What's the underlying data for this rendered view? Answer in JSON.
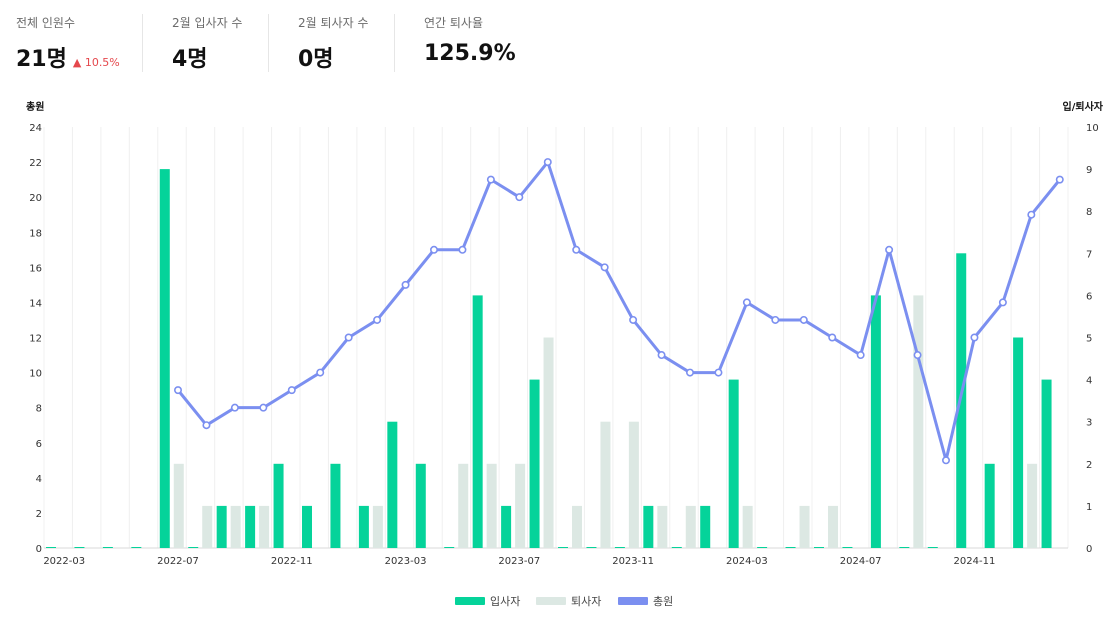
{
  "kpis": [
    {
      "label": "전체 인원수",
      "value": "21명",
      "delta": "▲ 10.5%"
    },
    {
      "label": "2월 입사자 수",
      "value": "4명"
    },
    {
      "label": "2월 퇴사자 수",
      "value": "0명"
    },
    {
      "label": "연간 퇴사율",
      "value": "125.9%"
    }
  ],
  "colors": {
    "hires": "#05d39a",
    "exits": "#dce8e3",
    "total": "#7b8ff0"
  },
  "chart_data": {
    "type": "bar",
    "x_tick_labels": [
      "2022-03",
      "2022-07",
      "2022-11",
      "2023-03",
      "2023-07",
      "2023-11",
      "2024-03",
      "2024-07",
      "2024-11"
    ],
    "y_left_label": "총원",
    "y_right_label": "입/퇴사자",
    "y_left_ticks": [
      "0",
      "2",
      "4",
      "6",
      "8",
      "10",
      "12",
      "14",
      "16",
      "18",
      "20",
      "22",
      "24"
    ],
    "y_right_ticks": [
      "0",
      "1",
      "2",
      "3",
      "4",
      "5",
      "6",
      "7",
      "8",
      "9",
      "10"
    ],
    "ylim_left": [
      0,
      24
    ],
    "ylim_right": [
      0,
      10
    ],
    "categories": [
      "2022-03",
      "2022-04",
      "2022-05",
      "2022-06",
      "2022-07",
      "2022-08",
      "2022-09",
      "2022-10",
      "2022-11",
      "2022-12",
      "2023-01",
      "2023-02",
      "2023-03",
      "2023-04",
      "2023-05",
      "2023-06",
      "2023-07",
      "2023-08",
      "2023-09",
      "2023-10",
      "2023-11",
      "2023-12",
      "2024-01",
      "2024-02",
      "2024-03",
      "2024-04",
      "2024-05",
      "2024-06",
      "2024-07",
      "2024-08",
      "2024-09",
      "2024-10",
      "2024-11",
      "2024-12",
      "2025-01",
      "2025-02"
    ],
    "series": [
      {
        "name": "입사자",
        "kind": "bar",
        "axis": "right",
        "values": [
          0,
          0,
          0,
          0,
          9,
          0,
          1,
          1,
          2,
          1,
          2,
          1,
          3,
          2,
          0,
          6,
          1,
          4,
          0,
          0,
          0,
          1,
          0,
          1,
          4,
          0,
          0,
          0,
          0,
          6,
          0,
          0,
          7,
          2,
          5,
          4
        ]
      },
      {
        "name": "퇴사자",
        "kind": "bar",
        "axis": "right",
        "values": [
          0,
          0,
          0,
          0,
          2,
          1,
          1,
          1,
          0,
          0,
          0,
          1,
          0,
          0,
          2,
          2,
          2,
          5,
          1,
          3,
          3,
          1,
          1,
          0,
          1,
          0,
          1,
          1,
          0,
          0,
          6,
          0,
          0,
          0,
          2,
          0
        ]
      },
      {
        "name": "총원",
        "kind": "line",
        "axis": "left",
        "values": [
          null,
          null,
          null,
          null,
          9,
          7,
          8,
          8,
          9,
          10,
          12,
          13,
          15,
          17,
          17,
          21,
          20,
          22,
          17,
          16,
          13,
          11,
          10,
          10,
          14,
          13,
          13,
          12,
          11,
          17,
          11,
          5,
          12,
          14,
          19,
          21
        ]
      }
    ],
    "grid": "vertical",
    "legend_position": "bottom-center"
  }
}
